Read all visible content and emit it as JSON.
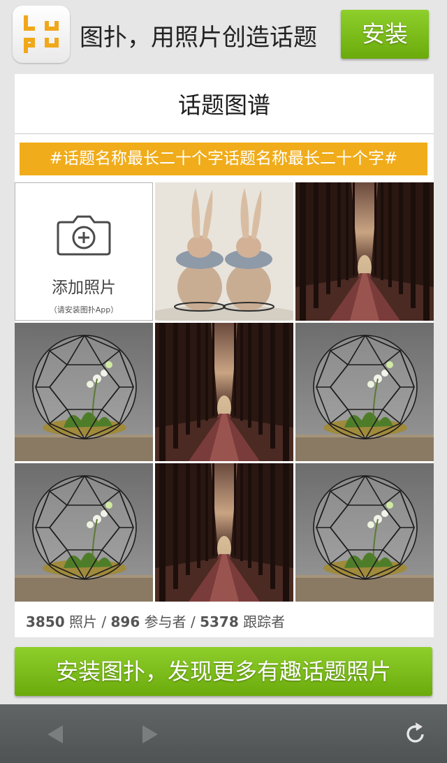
{
  "header": {
    "logo_letters": "tupu",
    "slogan": "图扑，用照片创造话题",
    "install_label": "安装"
  },
  "card": {
    "title": "话题图谱",
    "tag": "#话题名称最长二十个字话题名称最长二十个字#",
    "add_photo": {
      "label": "添加照片",
      "sublabel": "（请安装图扑App）"
    },
    "photos": [
      "rabbit-figurines-photo",
      "forest-path-photo",
      "glass-terrarium-photo",
      "forest-path-photo",
      "glass-terrarium-photo",
      "glass-terrarium-photo",
      "forest-path-photo",
      "glass-terrarium-photo"
    ],
    "stats": {
      "photos_count": "3850",
      "photos_label": "照片",
      "participants_count": "896",
      "participants_label": "参与者",
      "followers_count": "5378",
      "followers_label": "跟踪者",
      "separator": "/"
    }
  },
  "cta": {
    "label": "安装图扑，发现更多有趣话题照片"
  },
  "toolbar": {
    "back_icon": "back-arrow-icon",
    "forward_icon": "forward-arrow-icon",
    "refresh_icon": "refresh-icon"
  },
  "colors": {
    "green": "#7dbf1c",
    "tag_orange": "#f0ac1a",
    "logo_orange": "#f0a81a",
    "toolbar_gray": "#595c5c"
  }
}
